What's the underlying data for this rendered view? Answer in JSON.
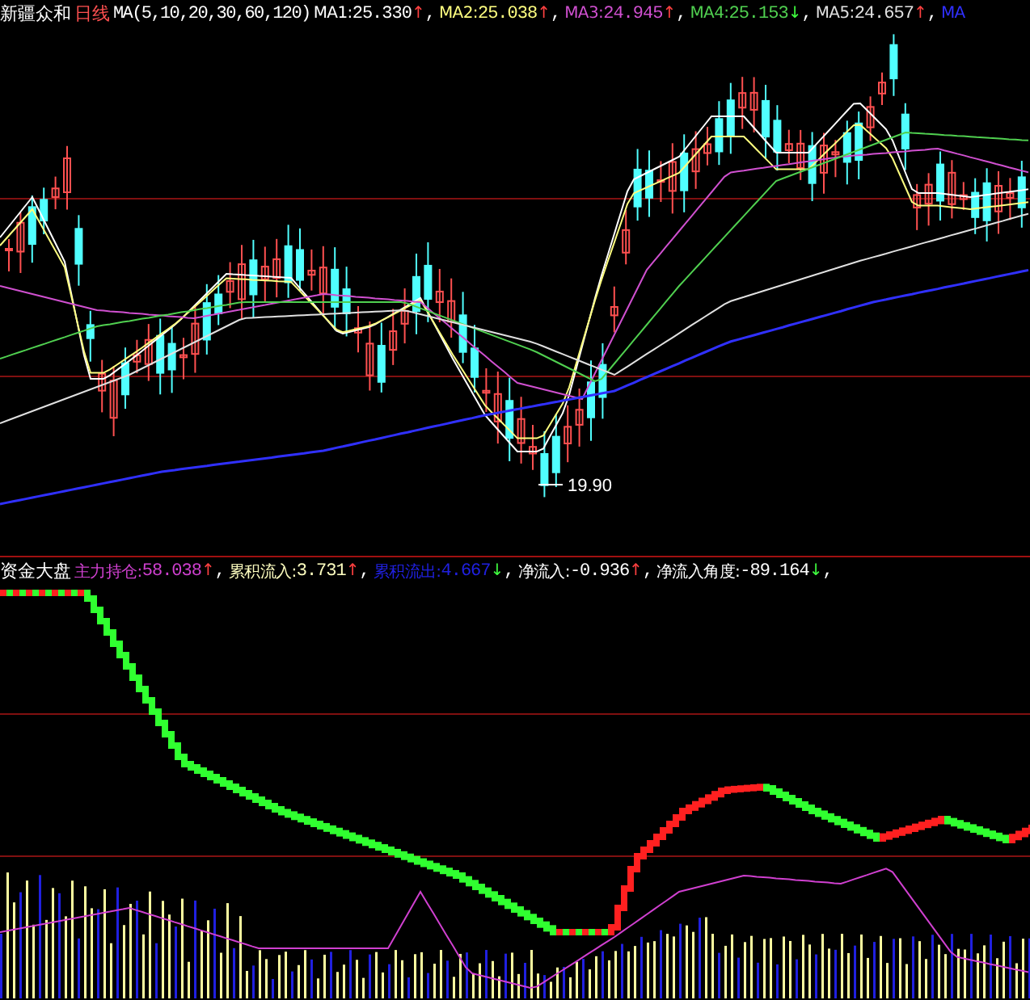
{
  "price_panel": {
    "stock": "新疆众和",
    "period": "日线",
    "ma_params": "MA(5,10,20,30,60,120)",
    "indicators": [
      {
        "label": "MA1:",
        "value": "25.330",
        "arrow": "↑",
        "rising": true,
        "separator": ",",
        "color": "#ffffff"
      },
      {
        "label": "MA2:",
        "value": "25.038",
        "arrow": "↑",
        "rising": true,
        "separator": ",",
        "color": "#ffff80"
      },
      {
        "label": "MA3:",
        "value": "24.945",
        "arrow": "↑",
        "rising": true,
        "separator": ",",
        "color": "#d050d0"
      },
      {
        "label": "MA4:",
        "value": "25.153",
        "arrow": "↓",
        "rising": false,
        "separator": ",",
        "color": "#50d050"
      },
      {
        "label": "MA5:",
        "value": "24.657",
        "arrow": "↑",
        "rising": true,
        "separator": ",",
        "color": "#e0e0e0"
      },
      {
        "label": "MA",
        "color": "#3030ff"
      }
    ],
    "low_label": "19.90"
  },
  "flow_panel": {
    "title": "资金大盘",
    "indicators": [
      {
        "label": "主力持仓:",
        "value": "58.038",
        "arrow": "↑",
        "rising": true,
        "separator": ",",
        "color": "#d040d0"
      },
      {
        "label": "累积流入:",
        "value": "3.731",
        "arrow": "↑",
        "rising": true,
        "separator": ",",
        "color": "#ffffc0"
      },
      {
        "label": "累积流出:",
        "value": "4.667",
        "arrow": "↓",
        "rising": false,
        "separator": ",",
        "color": "#2020e0"
      },
      {
        "label": "净流入:",
        "value": "-0.936",
        "arrow": "↑",
        "rising": true,
        "separator": ",",
        "color": "#ffffff"
      },
      {
        "label": "净流入角度:",
        "value": "-89.164",
        "arrow": "↓",
        "rising": false,
        "separator": ",",
        "color": "#ffffff"
      }
    ]
  }
}
